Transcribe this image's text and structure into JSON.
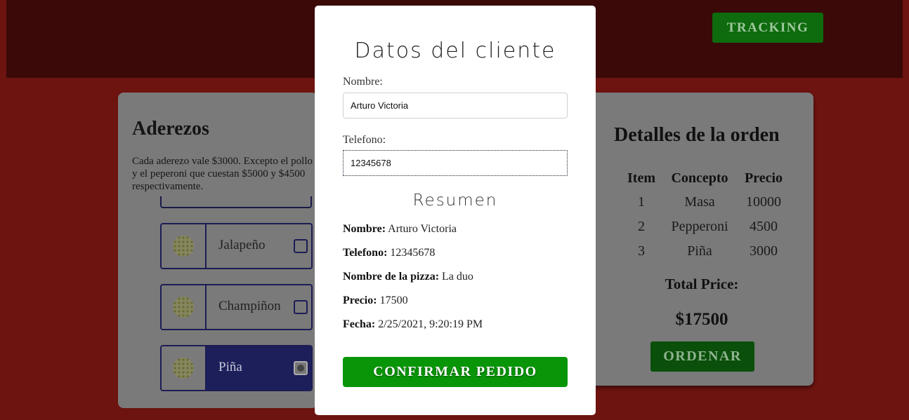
{
  "header": {
    "tracking_label": "TRACKING"
  },
  "aderezos": {
    "title": "Aderezos",
    "description": "Cada aderezo vale $3000. Excepto el pollo y el peperoni que cuestan $5000 y $4500 respectivamente.",
    "items": [
      {
        "label": "Jalapeño",
        "selected": false
      },
      {
        "label": "Champiñon",
        "selected": false
      },
      {
        "label": "Piña",
        "selected": true
      }
    ]
  },
  "orden": {
    "title": "Detalles de la orden",
    "columns": [
      "Item",
      "Concepto",
      "Precio"
    ],
    "rows": [
      [
        "1",
        "Masa",
        "10000"
      ],
      [
        "2",
        "Pepperoni",
        "4500"
      ],
      [
        "3",
        "Piña",
        "3000"
      ]
    ],
    "total_label": "Total Price:",
    "total_value": "$17500",
    "ordenar_label": "ORDENAR"
  },
  "modal": {
    "title": "Datos del cliente",
    "nombre_label": "Nombre:",
    "nombre_value": "Arturo Victoria",
    "telefono_label": "Telefono:",
    "telefono_value": "12345678",
    "resumen_title": "Resumen",
    "resumen": {
      "nombre_key": "Nombre:",
      "nombre_val": "Arturo Victoria",
      "telefono_key": "Telefono:",
      "telefono_val": "12345678",
      "pizza_key": "Nombre de la pizza:",
      "pizza_val": "La duo",
      "precio_key": "Precio:",
      "precio_val": "17500",
      "fecha_key": "Fecha:",
      "fecha_val": "2/25/2021, 9:20:19 PM"
    },
    "confirm_label": "CONFIRMAR PEDIDO"
  }
}
